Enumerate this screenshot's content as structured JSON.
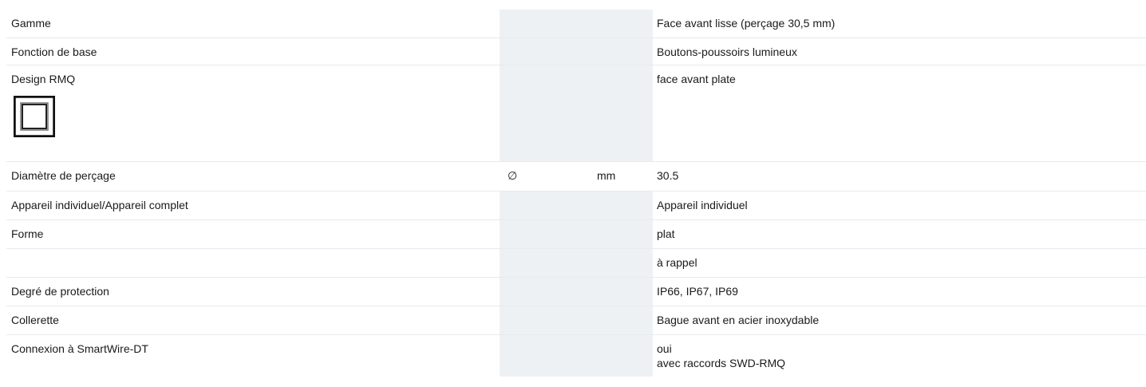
{
  "rows": [
    {
      "label": "Gamme",
      "symbol": "",
      "unit": "",
      "value": "Face avant lisse (perçage 30,5 mm)"
    },
    {
      "label": "Fonction de base",
      "symbol": "",
      "unit": "",
      "value": "Boutons-poussoirs lumineux"
    },
    {
      "label": "Design RMQ",
      "symbol": "",
      "unit": "",
      "value": "face avant plate",
      "icon": "rmq-flat-front-icon"
    },
    {
      "label": "Diamètre de perçage",
      "symbol": "∅",
      "unit": "mm",
      "value": "30.5"
    },
    {
      "label": "Appareil individuel/Appareil complet",
      "symbol": "",
      "unit": "",
      "value": "Appareil individuel"
    },
    {
      "label": "Forme",
      "symbol": "",
      "unit": "",
      "value": "plat"
    },
    {
      "label": "",
      "symbol": "",
      "unit": "",
      "value": "à rappel"
    },
    {
      "label": "Degré de protection",
      "symbol": "",
      "unit": "",
      "value": "IP66, IP67, IP69"
    },
    {
      "label": "Collerette",
      "symbol": "",
      "unit": "",
      "value": "Bague avant en acier inoxydable"
    },
    {
      "label": "Connexion à SmartWire-DT",
      "symbol": "",
      "unit": "",
      "value_lines": [
        "oui",
        "avec raccords SWD-RMQ"
      ]
    }
  ],
  "colors": {
    "heading": "#1f77c9",
    "shade": "#eef1f4",
    "divider": "#e6ebf0"
  }
}
